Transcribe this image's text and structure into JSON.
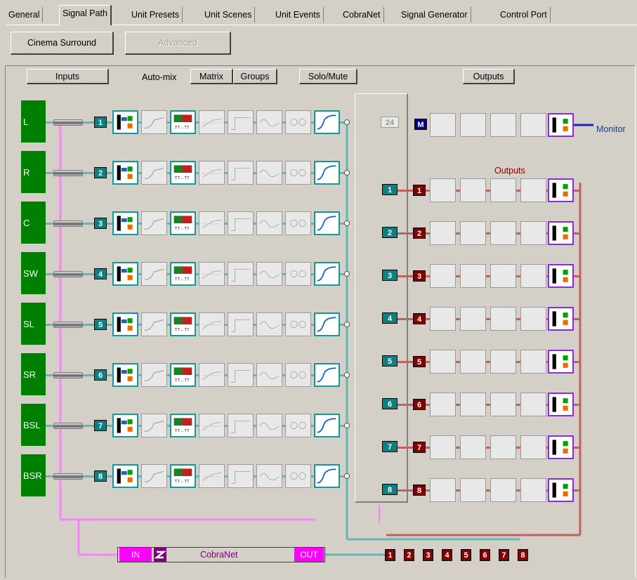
{
  "tabs": [
    "General",
    "Signal Path",
    "Unit Presets",
    "Unit Scenes",
    "Unit Events",
    "CobraNet",
    "Signal Generator",
    "Control Port"
  ],
  "active_tab": "Signal Path",
  "toolbar": {
    "cinema_label": "Cinema Surround",
    "advanced_label": "Advanced"
  },
  "header": {
    "inputs_label": "Inputs",
    "automix_label": "Auto-mix",
    "matrix_label": "Matrix",
    "groups_label": "Groups",
    "solo_mute_label": "Solo/Mute",
    "outputs_btn_label": "Outputs"
  },
  "inputs": [
    {
      "name": "L",
      "num": "1"
    },
    {
      "name": "R",
      "num": "2"
    },
    {
      "name": "C",
      "num": "3"
    },
    {
      "name": "SW",
      "num": "4"
    },
    {
      "name": "SL",
      "num": "5"
    },
    {
      "name": "SR",
      "num": "6"
    },
    {
      "name": "BSL",
      "num": "7"
    },
    {
      "name": "BSR",
      "num": "8"
    }
  ],
  "monitor": {
    "num": "24",
    "badge": "M",
    "label": "Monitor"
  },
  "outputs_heading": "Outputs",
  "outputs": [
    "1",
    "2",
    "3",
    "4",
    "5",
    "6",
    "7",
    "8"
  ],
  "cobranet": {
    "in_label": "IN",
    "name": "CobraNet",
    "out_label": "OUT",
    "channels": [
      "1",
      "2",
      "3",
      "4",
      "5",
      "6",
      "7",
      "8"
    ]
  },
  "colors": {
    "teal": "#0f8080",
    "maroon": "#800000",
    "green": "#008000",
    "magenta": "#ff00ff",
    "wire_teal": "#5fb8b8",
    "wire_pink": "#ff80ff",
    "monitor_blue": "#000080"
  }
}
